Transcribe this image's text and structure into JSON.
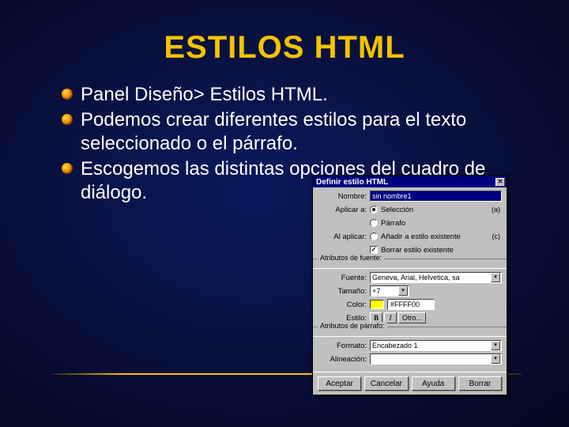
{
  "slide": {
    "title": "ESTILOS HTML",
    "bullets": [
      "Panel Diseño> Estilos HTML.",
      "Podemos crear diferentes estilos para el texto seleccionado o el párrafo.",
      "Escogemos las distintas opciones del cuadro de diálogo."
    ]
  },
  "dialog": {
    "title": "Definir estilo HTML",
    "close_glyph": "✕",
    "labels": {
      "nombre": "Nombre:",
      "aplicar": "Aplicar a:",
      "alaplicar": "Al aplicar:",
      "fuente": "Fuente:",
      "tamano": "Tamaño:",
      "color": "Color:",
      "estilo": "Estilo:",
      "formato": "Formato:",
      "alineacion": "Alineación:"
    },
    "sections": {
      "atrib_fuente": "Atributos de fuente:",
      "atrib_parrafo": "Atributos de párrafo:"
    },
    "nombre_value": "sin nombre1",
    "aplicar_options": {
      "seleccion": "Selección",
      "parrafo": "Párrafo"
    },
    "aplicar_hint": "(a)",
    "alaplicar_options": {
      "add": "Añadir a estilo existente",
      "clear": "Borrar estilo existente"
    },
    "alaplicar_hint": "(c)",
    "fuente_value": "Geneva, Arial, Helvetica, sa",
    "tamano_value": "+7",
    "color_hex": "#FFFF00",
    "style_buttons": {
      "bold": "B",
      "italic": "I",
      "other": "Otro..."
    },
    "formato_value": "Encabezado 1",
    "alineacion_value": "",
    "buttons": {
      "aceptar": "Aceptar",
      "cancelar": "Cancelar",
      "ayuda": "Ayuda",
      "borrar": "Borrar"
    },
    "dd_glyph": "▾"
  }
}
